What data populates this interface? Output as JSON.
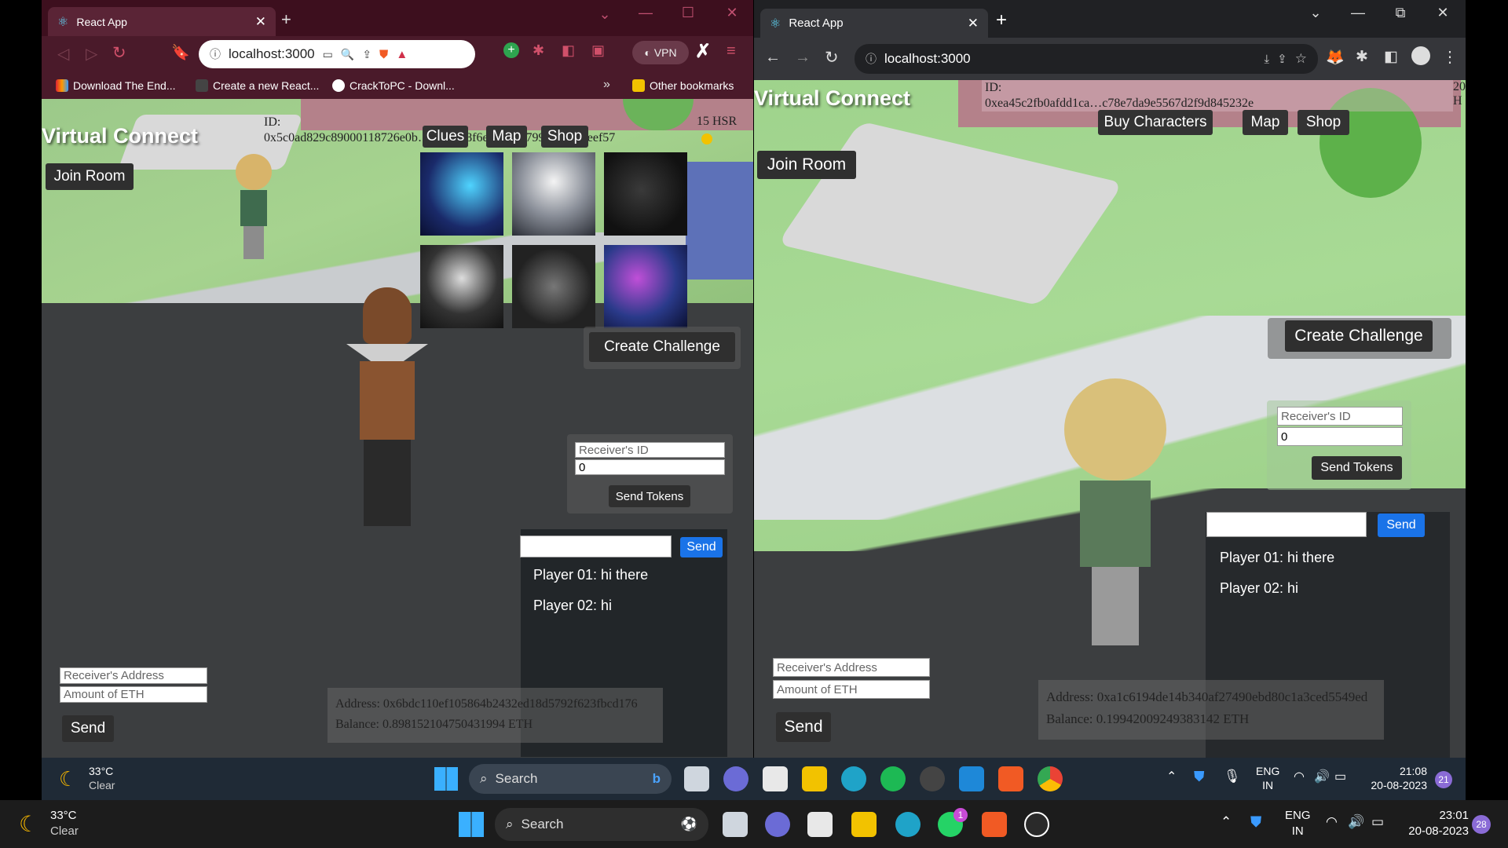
{
  "left_browser": {
    "tab_title": "React App",
    "url": "localhost:3000",
    "vpn_label": "VPN",
    "bookmarks": [
      "Download The End...",
      "Create a new React...",
      "CrackToPC - Downl...",
      "Other bookmarks"
    ],
    "bookmarks_more": "»",
    "colors": {
      "frame": "#3d0f1e",
      "toolbar": "#4a1a2a"
    }
  },
  "right_browser": {
    "tab_title": "React App",
    "url": "localhost:3000",
    "colors": {
      "frame": "#202124",
      "toolbar": "#35363a"
    }
  },
  "left_app": {
    "logo": "Virtual Connect",
    "join_room": "Join Room",
    "id_label": "ID:",
    "id_value": "0x5c0ad829c89000118726e0b…aa6bab8f6e5b7b3379924e51deeef57",
    "nav": [
      "Clues",
      "Map",
      "Shop"
    ],
    "hsr": "15 HSR",
    "create_challenge": "Create Challenge",
    "receiver_id_placeholder": "Receiver's ID",
    "amount_value": "0",
    "send_tokens": "Send Tokens",
    "chat_send": "Send",
    "chat_messages": [
      "Player 01: hi there",
      "Player 02: hi"
    ],
    "receiver_address_placeholder": "Receiver's Address",
    "amount_eth_placeholder": "Amount of ETH",
    "send": "Send",
    "address": "Address: 0x6bdc110ef105864b2432ed18d5792f623fbcd176",
    "balance": "Balance: 0.898152104750431994 ETH"
  },
  "right_app": {
    "logo": "Virtual Connect",
    "join_room": "Join Room",
    "id_label": "ID:",
    "id_value": "0xea45c2fb0afdd1ca…c78e7da9e5567d2f9d845232e",
    "nav": [
      "Buy Characters",
      "Map",
      "Shop"
    ],
    "hsr": "20 H",
    "create_challenge": "Create Challenge",
    "receiver_id_placeholder": "Receiver's ID",
    "amount_value": "0",
    "send_tokens": "Send Tokens",
    "chat_send": "Send",
    "chat_messages": [
      "Player 01: hi there",
      "Player 02: hi"
    ],
    "receiver_address_placeholder": "Receiver's Address",
    "amount_eth_placeholder": "Amount of ETH",
    "send": "Send",
    "address": "Address: 0xa1c6194de14b340af27490ebd80c1a3ced5549ed",
    "balance": "Balance: 0.19942009249383142 ETH"
  },
  "inner_taskbar": {
    "weather_temp": "33°C",
    "weather_desc": "Clear",
    "search": "Search",
    "lang": "ENG",
    "region": "IN",
    "time": "21:08",
    "date": "20-08-2023",
    "notif": "21"
  },
  "outer_taskbar": {
    "weather_temp": "33°C",
    "weather_desc": "Clear",
    "search": "Search",
    "whatsapp_badge": "1",
    "lang": "ENG",
    "region": "IN",
    "time": "23:01",
    "date": "20-08-2023",
    "notif": "28"
  }
}
